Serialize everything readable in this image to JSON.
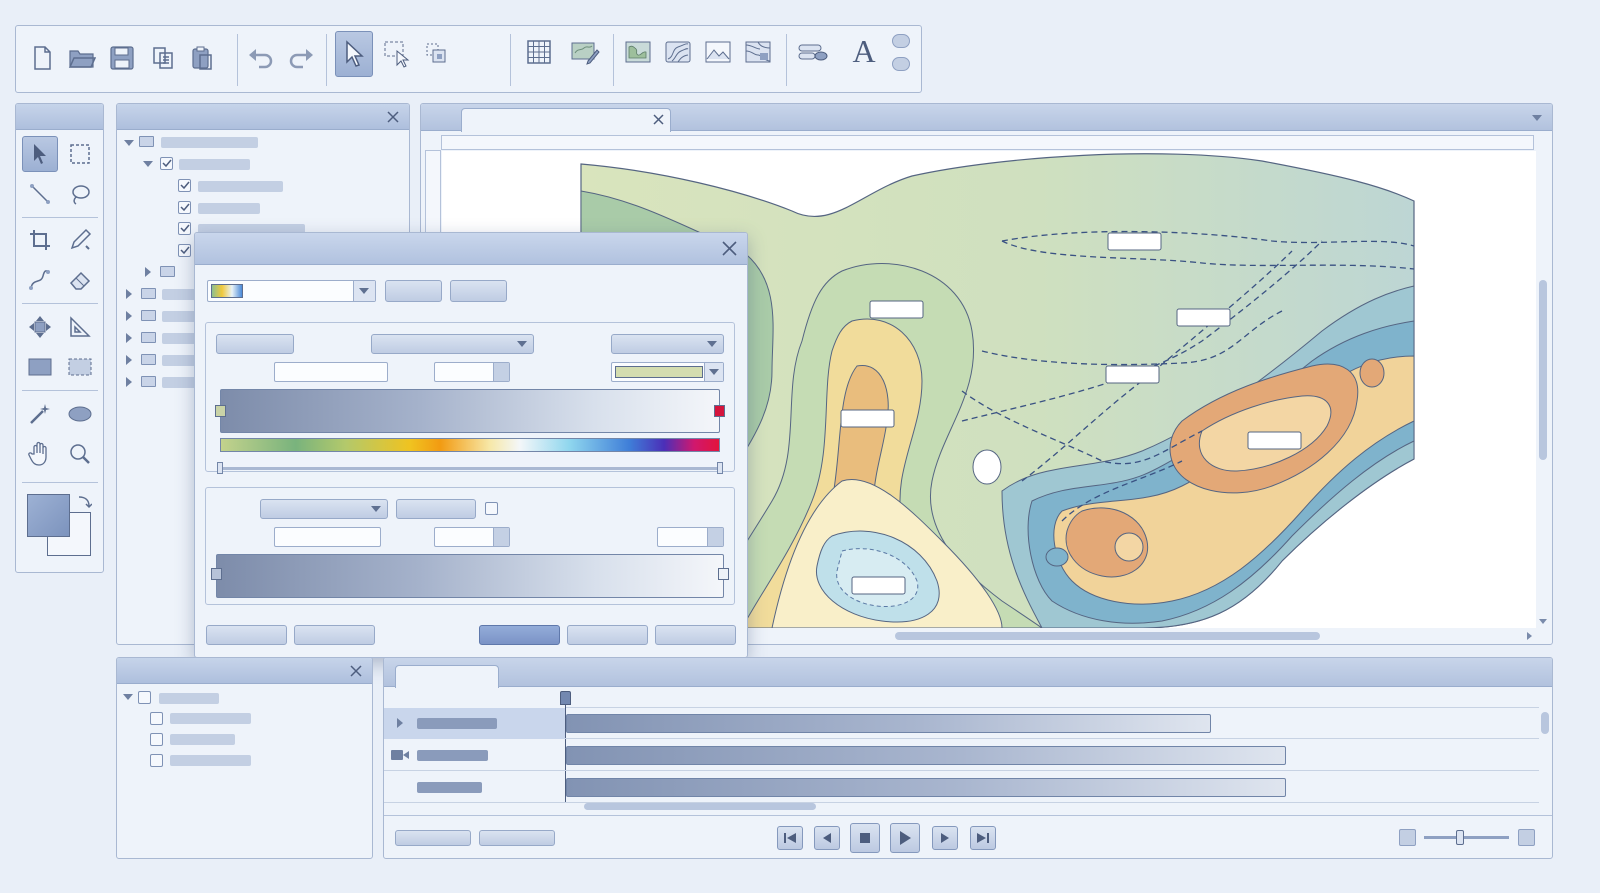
{
  "toolbar": {
    "buttons": [
      {
        "name": "new-file-icon"
      },
      {
        "name": "open-folder-icon"
      },
      {
        "name": "save-icon"
      },
      {
        "name": "copy-icon"
      },
      {
        "name": "paste-icon"
      },
      {
        "name": "undo-icon"
      },
      {
        "name": "redo-icon"
      },
      {
        "name": "select-arrow-icon"
      },
      {
        "name": "marquee-select-icon"
      },
      {
        "name": "transform-select-icon"
      },
      {
        "name": "grid-icon"
      },
      {
        "name": "edit-map-icon"
      },
      {
        "name": "world-map-icon"
      },
      {
        "name": "contour-map-icon"
      },
      {
        "name": "terrain-image-icon"
      },
      {
        "name": "layers-map-icon"
      },
      {
        "name": "symbology-icon"
      },
      {
        "name": "text-tool-icon"
      }
    ],
    "text_tool_label": "A"
  },
  "colors": {
    "accent": "#7b93c6",
    "panel_bg": "#eef3fa",
    "titlebar": "#b5c5e0",
    "ramp_start_stop": "#c9d3a7",
    "ramp_end_stop": "#d4143c"
  },
  "map": {
    "contour_colors": [
      "#d8e3be",
      "#c8dcb8",
      "#a9cba8",
      "#f3dc98",
      "#e9b97a",
      "#d9986a",
      "#bfe0ea",
      "#7fb6d2"
    ]
  },
  "playback": {
    "buttons": [
      "skip-start-icon",
      "step-back-icon",
      "stop-icon",
      "play-icon",
      "step-forward-icon",
      "skip-end-icon"
    ]
  }
}
